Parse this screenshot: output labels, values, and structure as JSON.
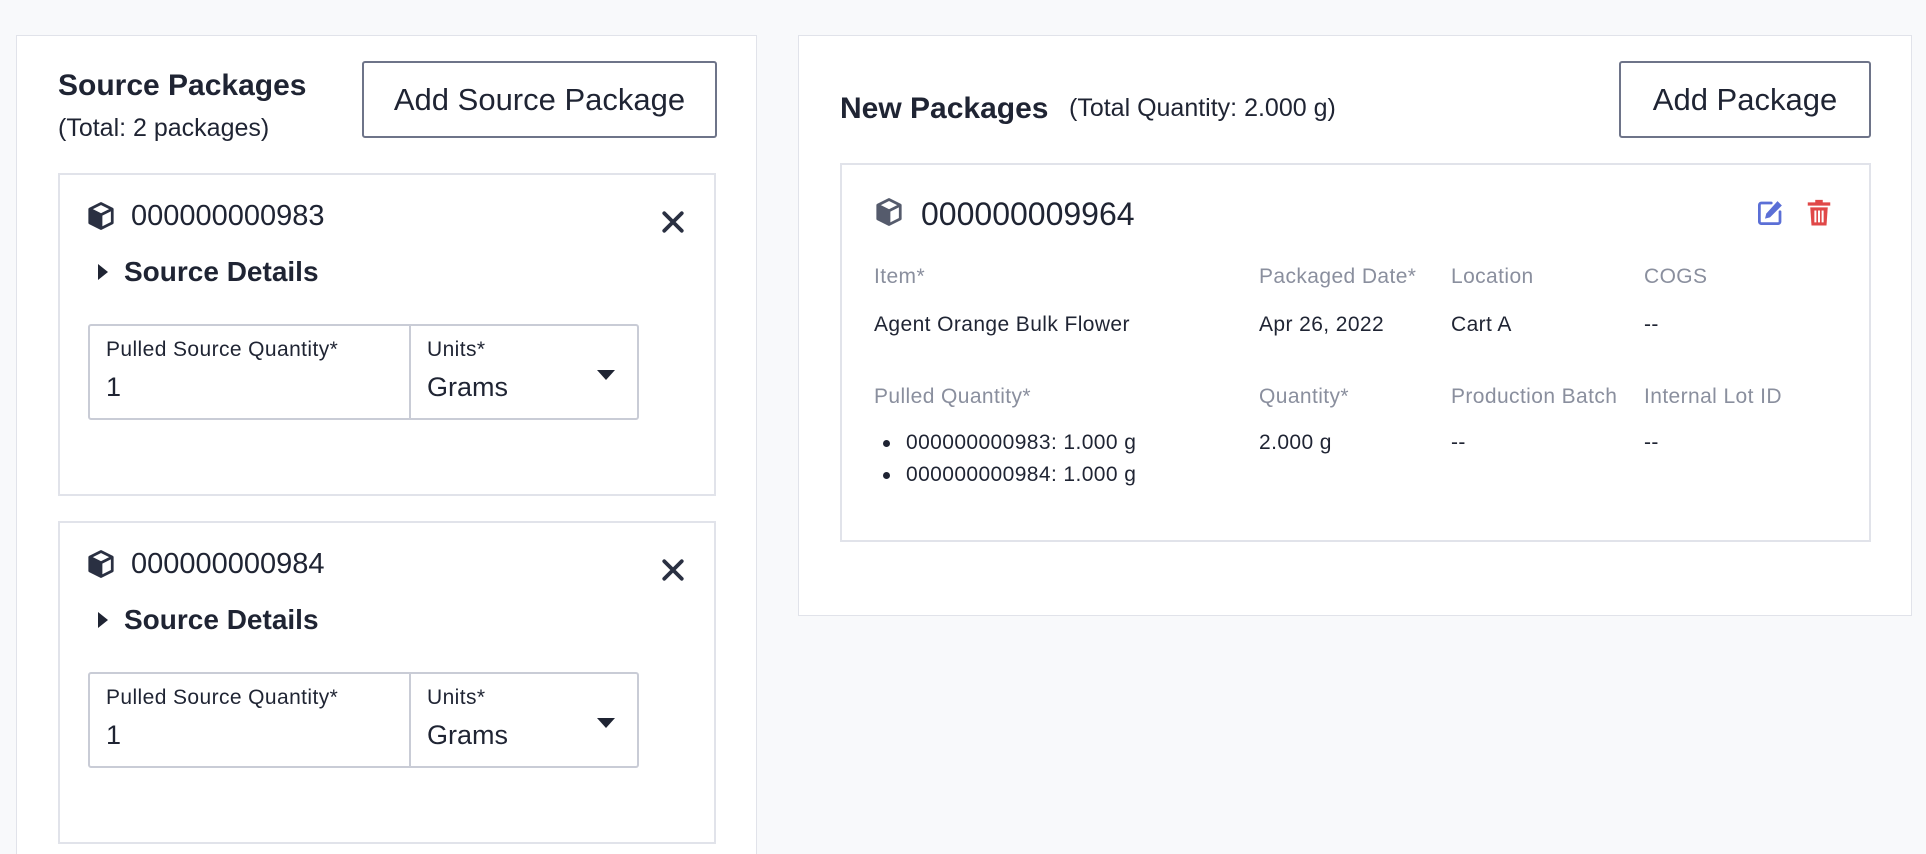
{
  "source_section": {
    "title": "Source Packages",
    "subtitle": "(Total: 2 packages)",
    "add_button": "Add Source Package",
    "packages": [
      {
        "id": "000000000983",
        "details_label": "Source Details",
        "quantity_label": "Pulled Source Quantity*",
        "quantity_value": "1",
        "units_label": "Units*",
        "units_value": "Grams"
      },
      {
        "id": "000000000984",
        "details_label": "Source Details",
        "quantity_label": "Pulled Source Quantity*",
        "quantity_value": "1",
        "units_label": "Units*",
        "units_value": "Grams"
      }
    ]
  },
  "new_section": {
    "title": "New Packages",
    "subtitle": "(Total Quantity: 2.000 g)",
    "add_button": "Add Package",
    "package": {
      "id": "000000009964",
      "labels": {
        "item": "Item*",
        "packaged_date": "Packaged Date*",
        "location": "Location",
        "cogs": "COGS",
        "pulled_quantity": "Pulled Quantity*",
        "quantity": "Quantity*",
        "production_batch": "Production Batch",
        "internal_lot_id": "Internal Lot ID"
      },
      "values": {
        "item": "Agent Orange Bulk Flower",
        "packaged_date": "Apr 26, 2022",
        "location": "Cart A",
        "cogs": "--",
        "quantity": "2.000 g",
        "production_batch": "--",
        "internal_lot_id": "--"
      },
      "pulled_quantities": [
        "000000000983: 1.000 g",
        "000000000984: 1.000 g"
      ]
    }
  },
  "colors": {
    "edit_icon": "#5b6fd6",
    "delete_icon": "#e04848",
    "muted_label": "#8a8f9e"
  },
  "icons": {
    "package": "package-icon",
    "close": "close-icon",
    "edit": "edit-icon",
    "delete": "trash-icon",
    "disclosure": "caret-right-icon",
    "dropdown": "caret-down-icon"
  }
}
